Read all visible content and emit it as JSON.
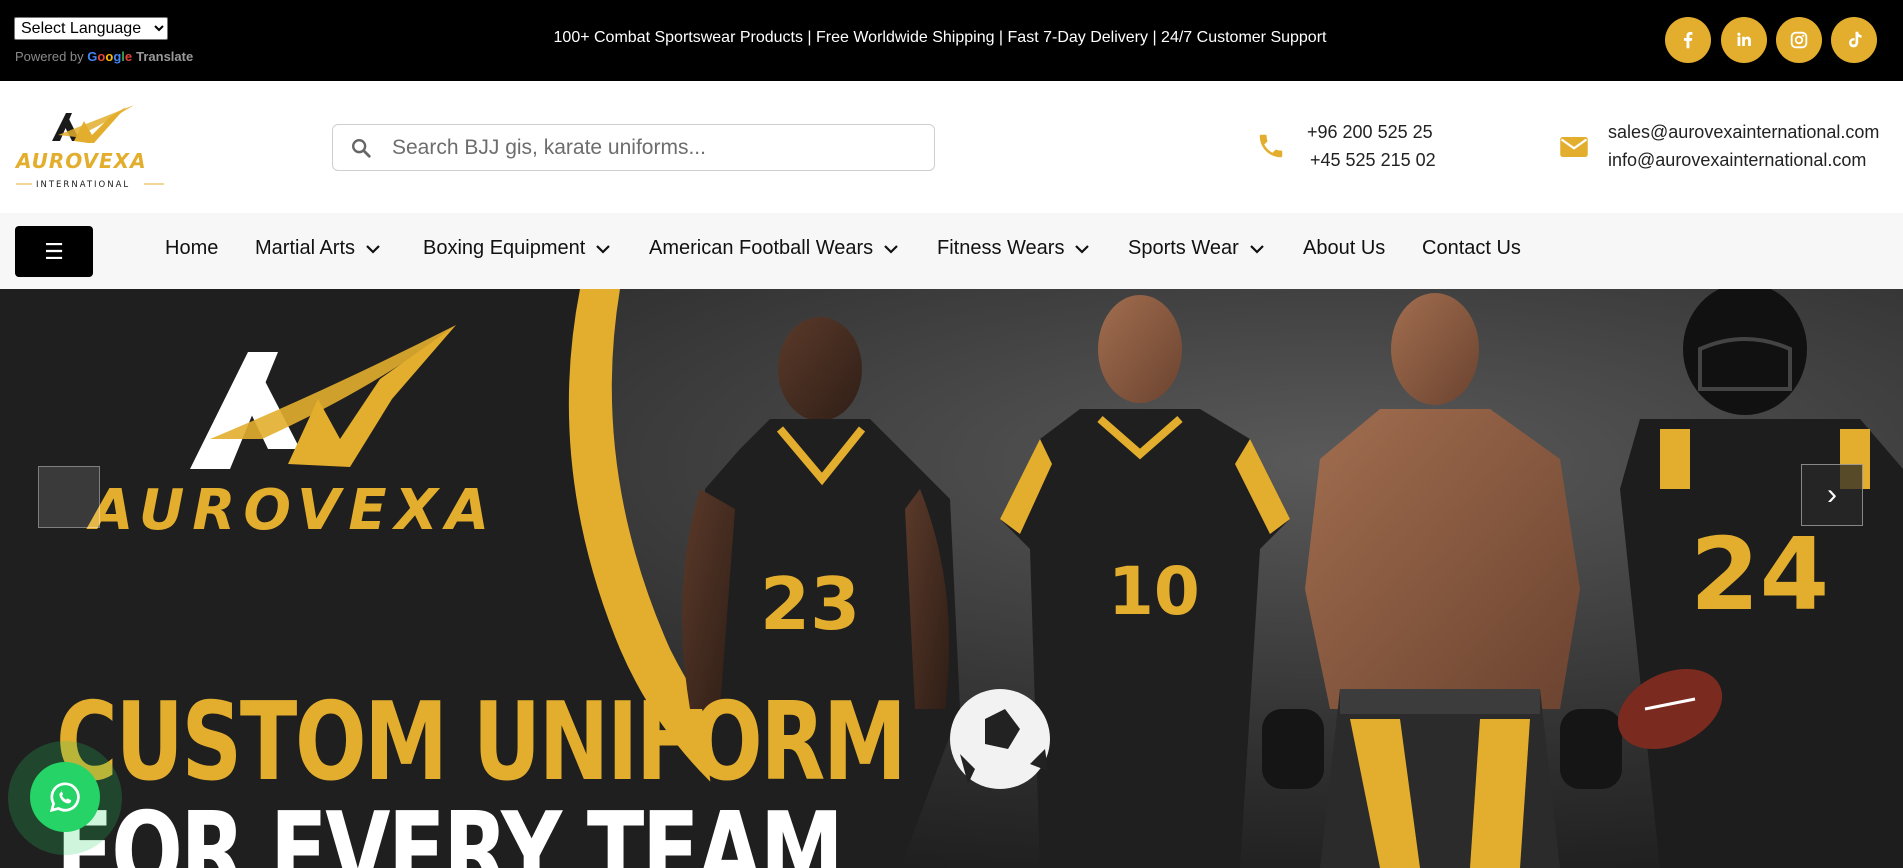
{
  "topbar": {
    "language_select": "Select Language",
    "powered_by": "Powered by",
    "google_letters": [
      "G",
      "o",
      "o",
      "g",
      "l",
      "e"
    ],
    "translate": "Translate",
    "announcement": "100+ Combat Sportswear Products | Free Worldwide Shipping | Fast 7-Day Delivery | 24/7 Customer Support",
    "social": [
      {
        "name": "facebook-icon"
      },
      {
        "name": "linkedin-icon"
      },
      {
        "name": "instagram-icon"
      },
      {
        "name": "tiktok-icon"
      }
    ]
  },
  "header": {
    "logo_text": "AUROVEXA",
    "logo_sub": "INTERNATIONAL",
    "search_placeholder": "Search BJJ gis, karate uniforms...",
    "phones": [
      "+96 200 525 25",
      "+45 525 215 02"
    ],
    "emails": [
      "sales@aurovexainternational.com",
      "info@aurovexainternational.com"
    ]
  },
  "nav": {
    "menu_glyph": "☰",
    "items": [
      {
        "label": "Home",
        "dropdown": false
      },
      {
        "label": "Martial Arts",
        "dropdown": true
      },
      {
        "label": "Boxing Equipment",
        "dropdown": true
      },
      {
        "label": "American Football Wears",
        "dropdown": true
      },
      {
        "label": "Fitness Wears",
        "dropdown": true
      },
      {
        "label": "Sports Wear",
        "dropdown": true
      },
      {
        "label": "About Us",
        "dropdown": false
      },
      {
        "label": "Contact Us",
        "dropdown": false
      }
    ]
  },
  "hero": {
    "brand_word": "AUROVEXA",
    "headline_line1": "CUSTOM UNIFORM",
    "headline_line2": "FOR EVERY TEAM",
    "jersey_numbers": [
      "23",
      "10",
      "24"
    ],
    "next_glyph": "›"
  },
  "colors": {
    "accent": "#e3ae2d",
    "topbar_bg": "#000000",
    "whatsapp": "#25d366"
  }
}
